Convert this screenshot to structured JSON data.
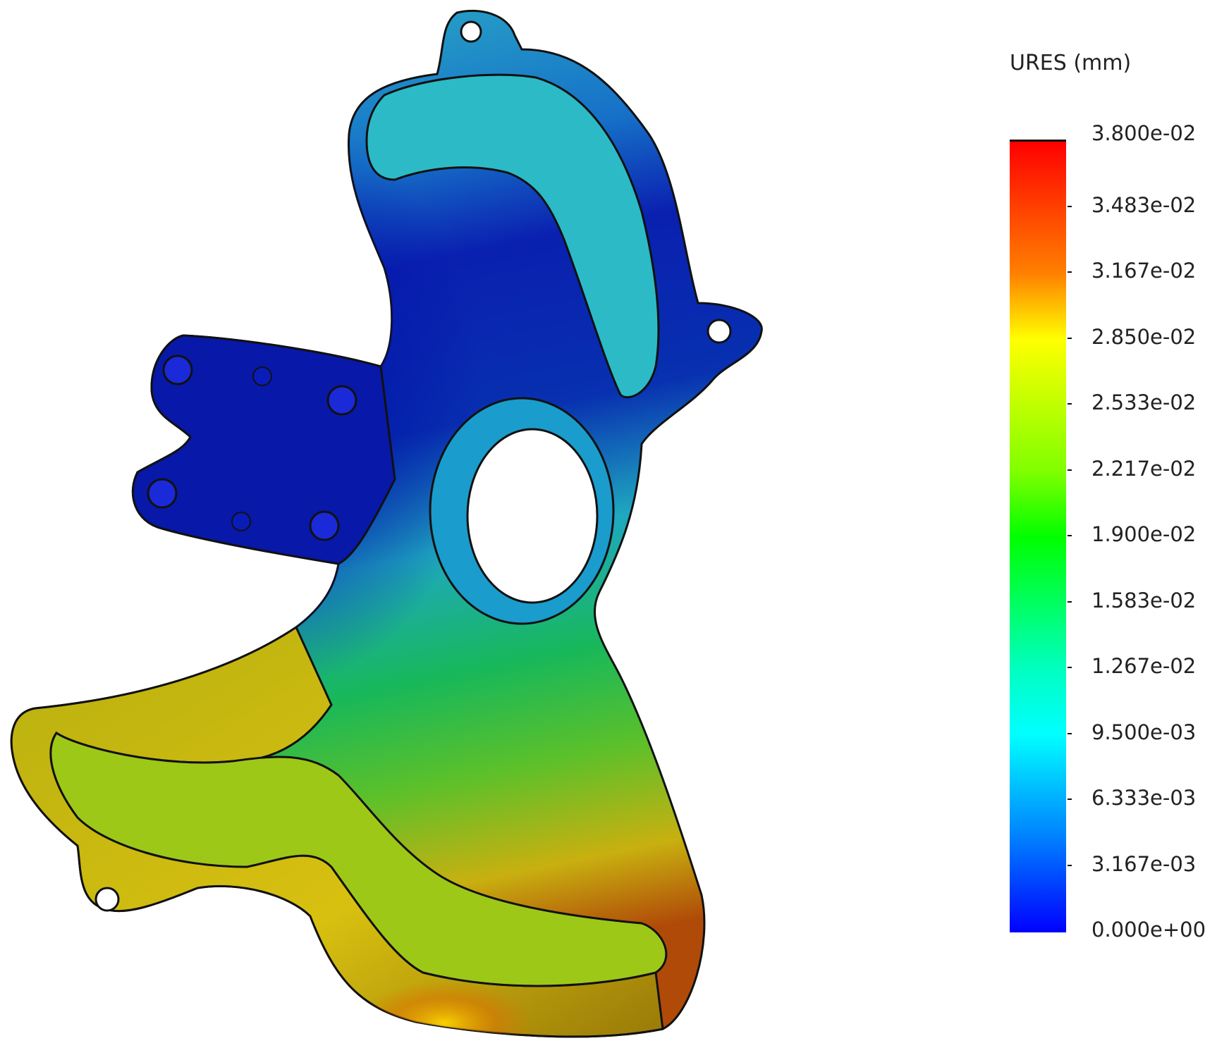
{
  "legend": {
    "title": "URES (mm)",
    "labels": [
      "3.800e-02",
      "3.483e-02",
      "3.167e-02",
      "2.850e-02",
      "2.533e-02",
      "2.217e-02",
      "1.900e-02",
      "1.583e-02",
      "1.267e-02",
      "9.500e-03",
      "6.333e-03",
      "3.167e-03",
      "0.000e+00"
    ]
  },
  "colors": {
    "max": "#ff0000",
    "high": "#ff8000",
    "upper_mid": "#ffff00",
    "mid": "#00ff00",
    "lower_mid": "#00ffff",
    "low": "#0080ff",
    "min": "#0000ff"
  }
}
